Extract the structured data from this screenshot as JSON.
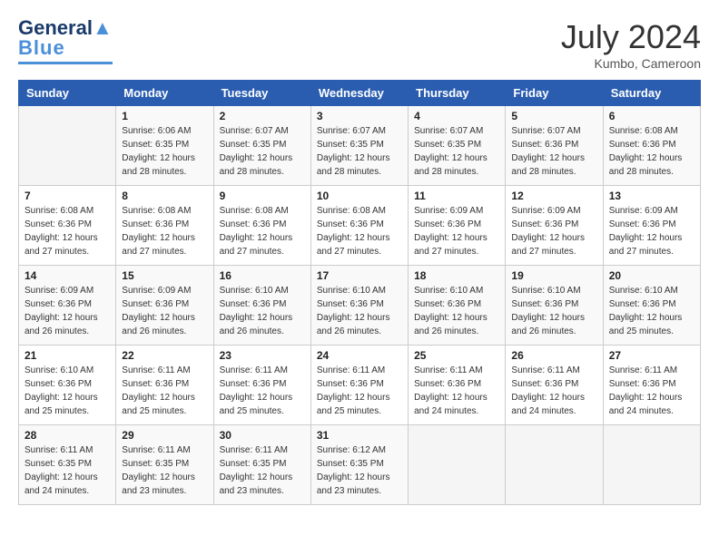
{
  "header": {
    "logo_general": "General",
    "logo_blue": "Blue",
    "month_year": "July 2024",
    "location": "Kumbo, Cameroon"
  },
  "weekdays": [
    "Sunday",
    "Monday",
    "Tuesday",
    "Wednesday",
    "Thursday",
    "Friday",
    "Saturday"
  ],
  "weeks": [
    [
      {
        "day": "",
        "sunrise": "",
        "sunset": "",
        "daylight": ""
      },
      {
        "day": "1",
        "sunrise": "6:06 AM",
        "sunset": "6:35 PM",
        "daylight": "12 hours and 28 minutes."
      },
      {
        "day": "2",
        "sunrise": "6:07 AM",
        "sunset": "6:35 PM",
        "daylight": "12 hours and 28 minutes."
      },
      {
        "day": "3",
        "sunrise": "6:07 AM",
        "sunset": "6:35 PM",
        "daylight": "12 hours and 28 minutes."
      },
      {
        "day": "4",
        "sunrise": "6:07 AM",
        "sunset": "6:35 PM",
        "daylight": "12 hours and 28 minutes."
      },
      {
        "day": "5",
        "sunrise": "6:07 AM",
        "sunset": "6:36 PM",
        "daylight": "12 hours and 28 minutes."
      },
      {
        "day": "6",
        "sunrise": "6:08 AM",
        "sunset": "6:36 PM",
        "daylight": "12 hours and 28 minutes."
      }
    ],
    [
      {
        "day": "7",
        "sunrise": "6:08 AM",
        "sunset": "6:36 PM",
        "daylight": "12 hours and 27 minutes."
      },
      {
        "day": "8",
        "sunrise": "6:08 AM",
        "sunset": "6:36 PM",
        "daylight": "12 hours and 27 minutes."
      },
      {
        "day": "9",
        "sunrise": "6:08 AM",
        "sunset": "6:36 PM",
        "daylight": "12 hours and 27 minutes."
      },
      {
        "day": "10",
        "sunrise": "6:08 AM",
        "sunset": "6:36 PM",
        "daylight": "12 hours and 27 minutes."
      },
      {
        "day": "11",
        "sunrise": "6:09 AM",
        "sunset": "6:36 PM",
        "daylight": "12 hours and 27 minutes."
      },
      {
        "day": "12",
        "sunrise": "6:09 AM",
        "sunset": "6:36 PM",
        "daylight": "12 hours and 27 minutes."
      },
      {
        "day": "13",
        "sunrise": "6:09 AM",
        "sunset": "6:36 PM",
        "daylight": "12 hours and 27 minutes."
      }
    ],
    [
      {
        "day": "14",
        "sunrise": "6:09 AM",
        "sunset": "6:36 PM",
        "daylight": "12 hours and 26 minutes."
      },
      {
        "day": "15",
        "sunrise": "6:09 AM",
        "sunset": "6:36 PM",
        "daylight": "12 hours and 26 minutes."
      },
      {
        "day": "16",
        "sunrise": "6:10 AM",
        "sunset": "6:36 PM",
        "daylight": "12 hours and 26 minutes."
      },
      {
        "day": "17",
        "sunrise": "6:10 AM",
        "sunset": "6:36 PM",
        "daylight": "12 hours and 26 minutes."
      },
      {
        "day": "18",
        "sunrise": "6:10 AM",
        "sunset": "6:36 PM",
        "daylight": "12 hours and 26 minutes."
      },
      {
        "day": "19",
        "sunrise": "6:10 AM",
        "sunset": "6:36 PM",
        "daylight": "12 hours and 26 minutes."
      },
      {
        "day": "20",
        "sunrise": "6:10 AM",
        "sunset": "6:36 PM",
        "daylight": "12 hours and 25 minutes."
      }
    ],
    [
      {
        "day": "21",
        "sunrise": "6:10 AM",
        "sunset": "6:36 PM",
        "daylight": "12 hours and 25 minutes."
      },
      {
        "day": "22",
        "sunrise": "6:11 AM",
        "sunset": "6:36 PM",
        "daylight": "12 hours and 25 minutes."
      },
      {
        "day": "23",
        "sunrise": "6:11 AM",
        "sunset": "6:36 PM",
        "daylight": "12 hours and 25 minutes."
      },
      {
        "day": "24",
        "sunrise": "6:11 AM",
        "sunset": "6:36 PM",
        "daylight": "12 hours and 25 minutes."
      },
      {
        "day": "25",
        "sunrise": "6:11 AM",
        "sunset": "6:36 PM",
        "daylight": "12 hours and 24 minutes."
      },
      {
        "day": "26",
        "sunrise": "6:11 AM",
        "sunset": "6:36 PM",
        "daylight": "12 hours and 24 minutes."
      },
      {
        "day": "27",
        "sunrise": "6:11 AM",
        "sunset": "6:36 PM",
        "daylight": "12 hours and 24 minutes."
      }
    ],
    [
      {
        "day": "28",
        "sunrise": "6:11 AM",
        "sunset": "6:35 PM",
        "daylight": "12 hours and 24 minutes."
      },
      {
        "day": "29",
        "sunrise": "6:11 AM",
        "sunset": "6:35 PM",
        "daylight": "12 hours and 23 minutes."
      },
      {
        "day": "30",
        "sunrise": "6:11 AM",
        "sunset": "6:35 PM",
        "daylight": "12 hours and 23 minutes."
      },
      {
        "day": "31",
        "sunrise": "6:12 AM",
        "sunset": "6:35 PM",
        "daylight": "12 hours and 23 minutes."
      },
      {
        "day": "",
        "sunrise": "",
        "sunset": "",
        "daylight": ""
      },
      {
        "day": "",
        "sunrise": "",
        "sunset": "",
        "daylight": ""
      },
      {
        "day": "",
        "sunrise": "",
        "sunset": "",
        "daylight": ""
      }
    ]
  ]
}
